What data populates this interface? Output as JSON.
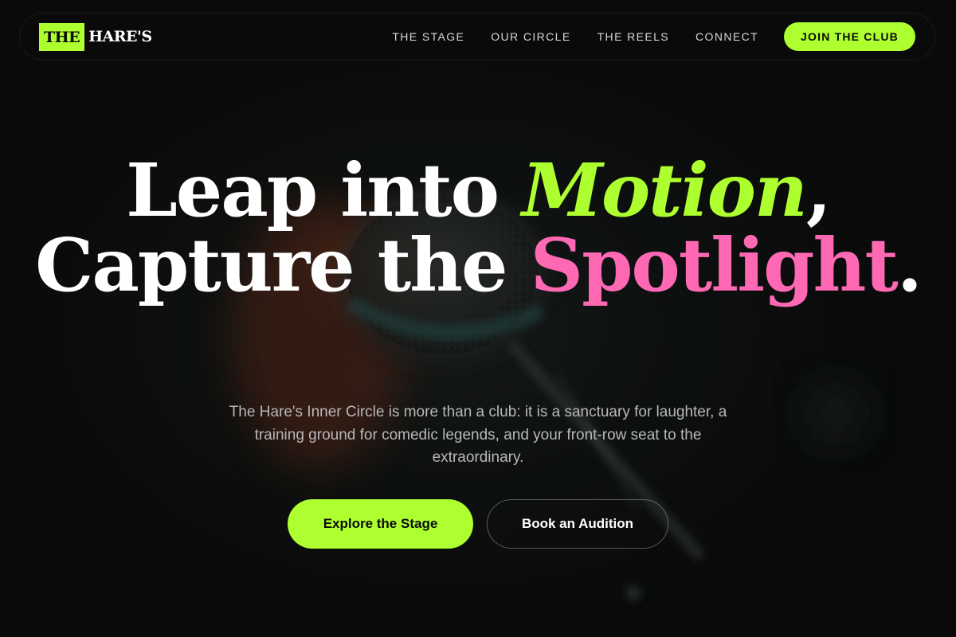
{
  "brand": {
    "logo_mark": "THE",
    "logo_word": "HARE'S"
  },
  "nav": {
    "links": [
      {
        "label": "THE STAGE"
      },
      {
        "label": "OUR CIRCLE"
      },
      {
        "label": "THE REELS"
      },
      {
        "label": "CONNECT"
      }
    ],
    "cta_label": "JOIN THE CLUB"
  },
  "hero": {
    "headline": {
      "part1": "Leap into ",
      "accent1": "Motion",
      "part2": ", Capture the ",
      "accent2": "Spotlight",
      "part3": "."
    },
    "subtext": "The Hare's Inner Circle is more than a club: it is a sanctuary for laughter, a training ground for comedic legends, and your front-row seat to the extraordinary.",
    "primary_button": "Explore the Stage",
    "secondary_button": "Book an Audition"
  },
  "colors": {
    "accent_green": "#adff2f",
    "accent_pink": "#ff69b4",
    "background": "#0d0f0e"
  },
  "icons": {
    "background_image": "microphone-photo"
  }
}
